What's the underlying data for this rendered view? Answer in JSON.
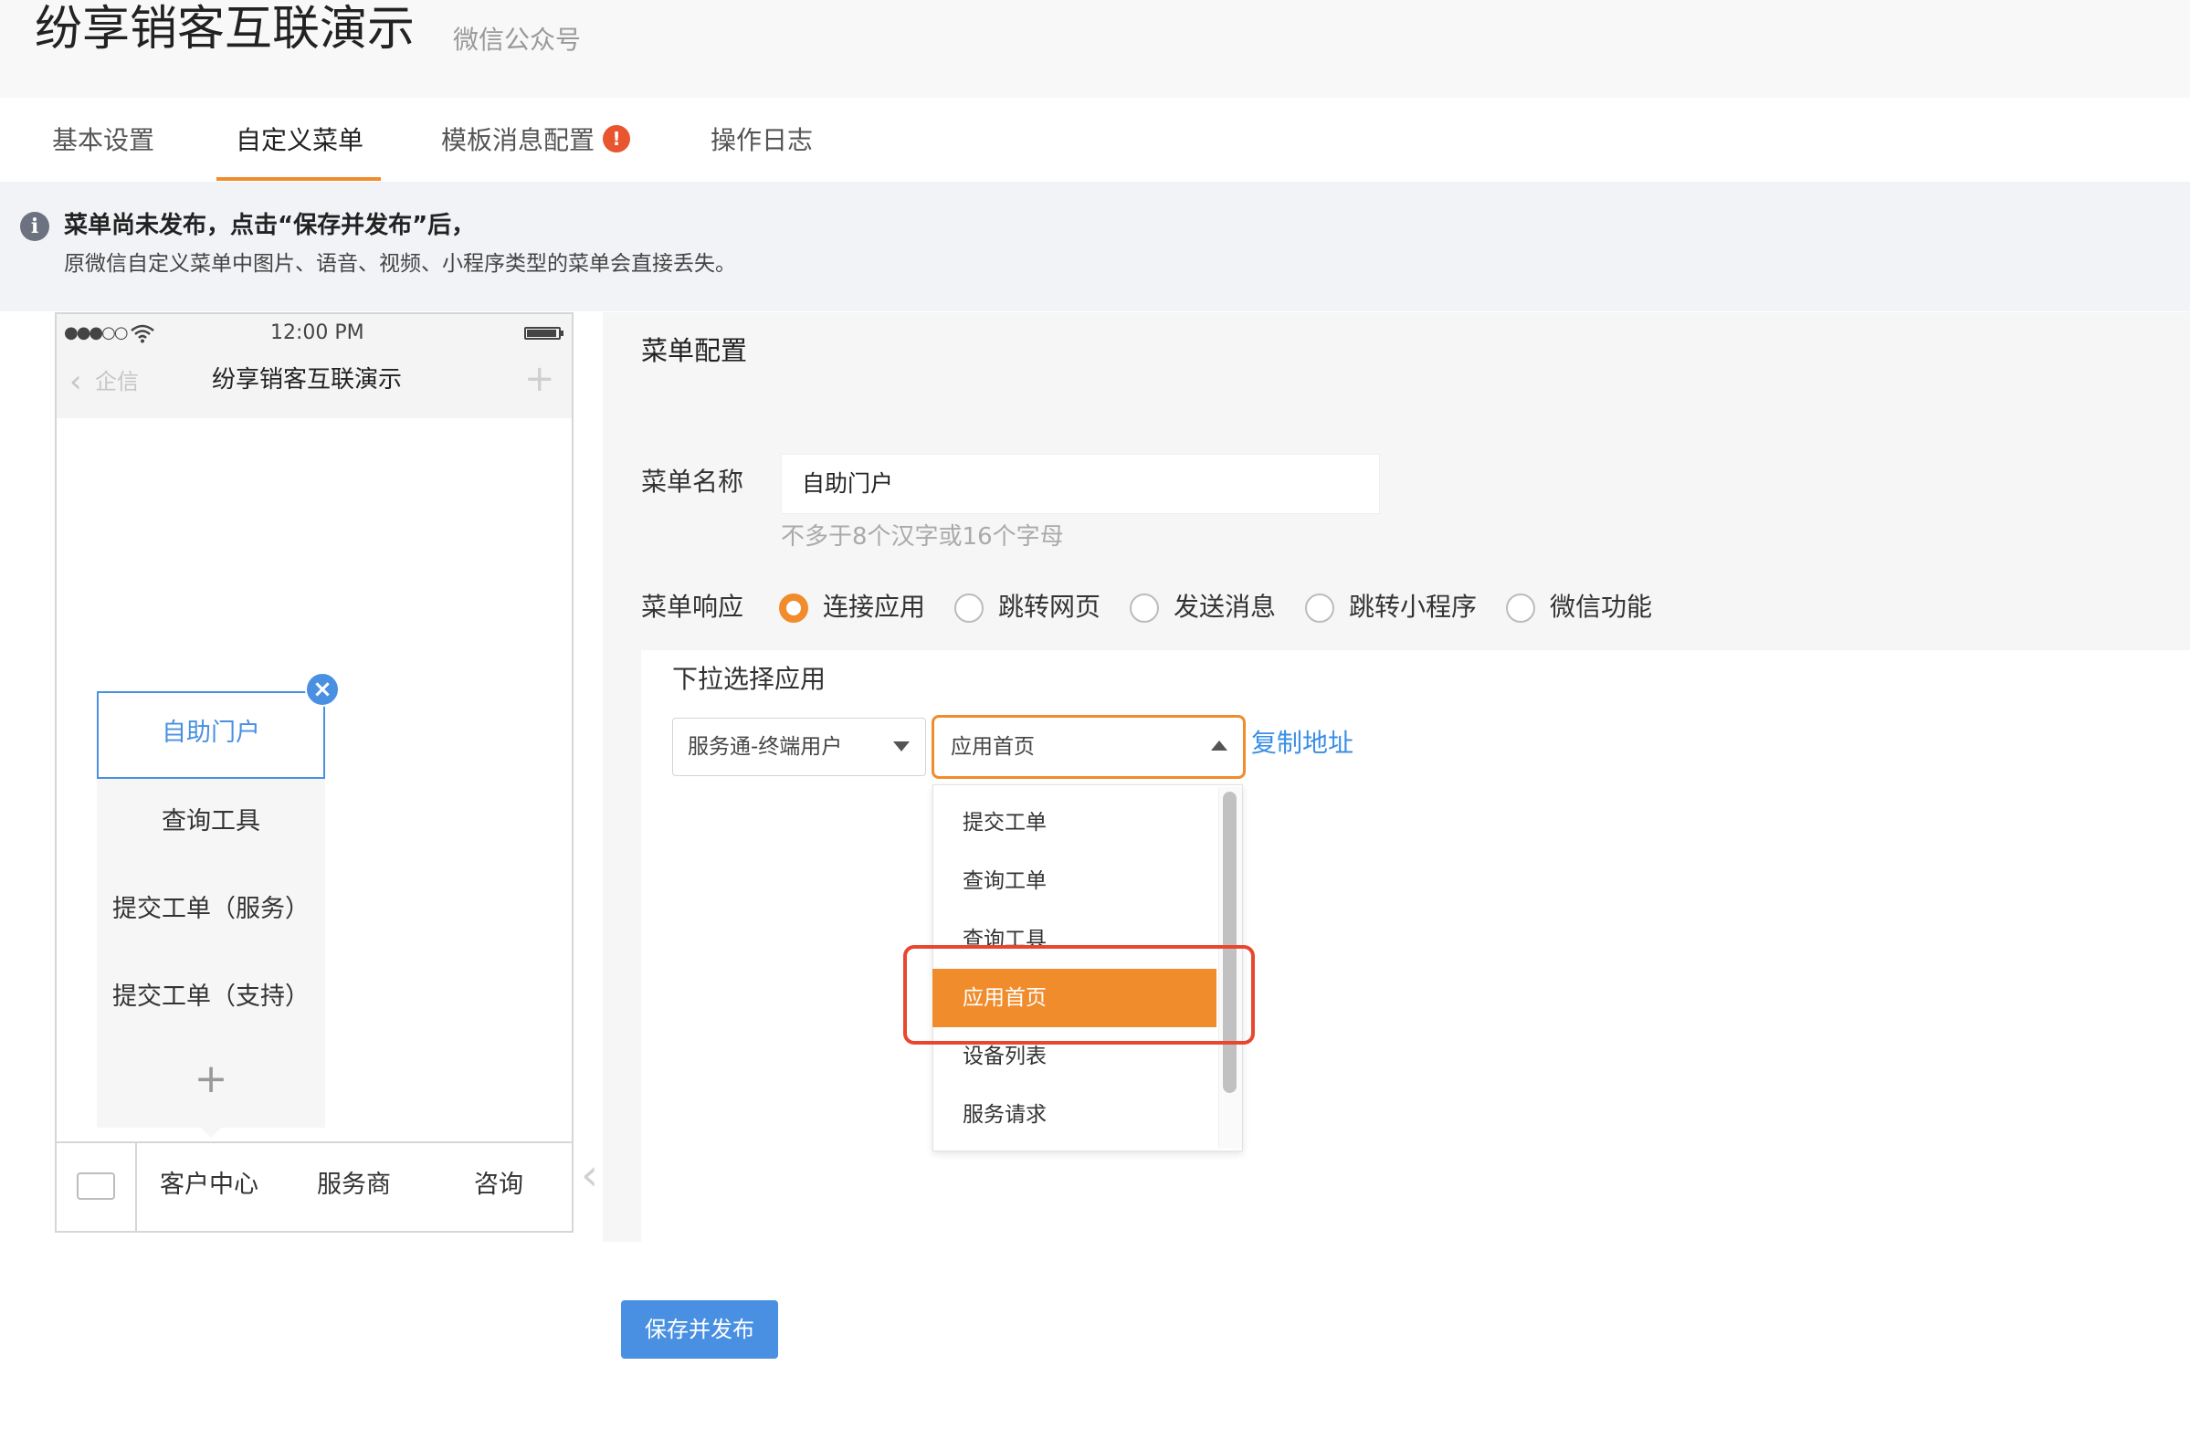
{
  "header": {
    "title": "纷享销客互联演示",
    "subtitle": "微信公众号"
  },
  "tabs": [
    {
      "label": "基本设置"
    },
    {
      "label": "自定义菜单"
    },
    {
      "label": "模板消息配置",
      "badge": "!"
    },
    {
      "label": "操作日志"
    }
  ],
  "notice": {
    "title": "菜单尚未发布，点击“保存并发布”后，",
    "desc": "原微信自定义菜单中图片、语音、视频、小程序类型的菜单会直接丢失。"
  },
  "phone": {
    "status_dots": "●●●○○",
    "time": "12:00 PM",
    "back_label": "企信",
    "title": "纷享销客互联演示",
    "submenu": [
      "自助门户",
      "查询工具",
      "提交工单（服务）",
      "提交工单（支持）"
    ],
    "main_menu": [
      "客户中心",
      "服务商",
      "咨询"
    ]
  },
  "config": {
    "title": "菜单配置",
    "name_label": "菜单名称",
    "name_value": "自助门户",
    "name_hint": "不多于8个汉字或16个字母",
    "response_label": "菜单响应",
    "options": [
      {
        "label": "连接应用",
        "checked": true
      },
      {
        "label": "跳转网页",
        "checked": false
      },
      {
        "label": "发送消息",
        "checked": false
      },
      {
        "label": "跳转小程序",
        "checked": false
      },
      {
        "label": "微信功能",
        "checked": false
      }
    ],
    "select_label": "下拉选择应用",
    "select1_value": "服务通-终端用户",
    "select2_value": "应用首页",
    "copy_link": "复制地址",
    "dropdown_items": [
      "提交工单",
      "查询工单",
      "查询工具",
      "应用首页",
      "设备列表",
      "服务请求"
    ],
    "dropdown_selected": "应用首页"
  },
  "save_button": "保存并发布",
  "colors": {
    "accent": "#f08c2c",
    "primary": "#4a90e2",
    "highlight": "#e8472f"
  }
}
